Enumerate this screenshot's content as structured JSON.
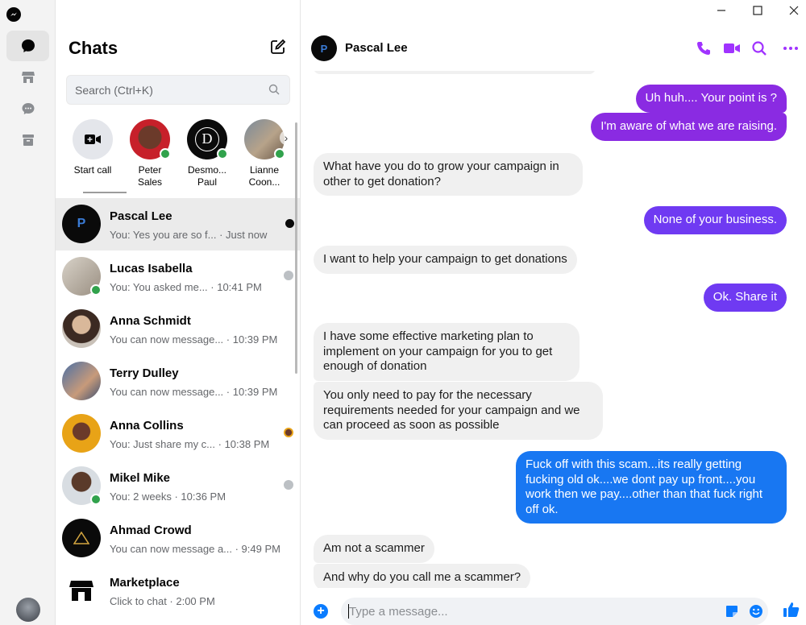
{
  "colors": {
    "accent_purple": "#a033ff",
    "bubble_in": "#f0f0f0",
    "bubble_purple": "#8a2be2",
    "bubble_violet": "#6f3af2",
    "bubble_blue": "#1877f2",
    "online": "#31a24c",
    "messenger_blue": "#0a7cff"
  },
  "window": {
    "minimize_icon": "minimize-icon",
    "maximize_icon": "maximize-icon",
    "close_icon": "close-icon"
  },
  "rail": {
    "items": [
      "chats-icon",
      "marketplace-icon",
      "requests-icon",
      "archive-icon"
    ]
  },
  "sidebar": {
    "title": "Chats",
    "search_placeholder": "Search (Ctrl+K)",
    "stories": [
      {
        "label": "Start call"
      },
      {
        "label": "Peter Sales",
        "online": true
      },
      {
        "label": "Desmo... Paul",
        "online": true
      },
      {
        "label": "Lianne Coon...",
        "online": true
      }
    ],
    "threads": [
      {
        "name": "Pascal Lee",
        "preview": "You: Yes you are so f... · Just now",
        "active": true
      },
      {
        "name": "Lucas Isabella",
        "preview": "You: You asked me... · 10:41 PM",
        "online": true
      },
      {
        "name": "Anna Schmidt",
        "preview": "You can now message... · 10:39 PM"
      },
      {
        "name": "Terry Dulley",
        "preview": "You can now message... · 10:39 PM"
      },
      {
        "name": "Anna Collins",
        "preview": "You: Just share my c... · 10:38 PM"
      },
      {
        "name": "Mikel Mike",
        "preview": "You: 2 weeks · 10:36 PM",
        "online": true
      },
      {
        "name": "Ahmad Crowd",
        "preview": "You can now message a... · 9:49 PM"
      },
      {
        "name": "Marketplace",
        "preview": "Click to chat · 2:00 PM"
      }
    ]
  },
  "conversation": {
    "contact_name": "Pascal Lee",
    "messages": [
      {
        "from": "me",
        "text": "Uh huh.... Your point is ?"
      },
      {
        "from": "me",
        "text": "I'm aware of what we are raising."
      },
      {
        "from": "them",
        "text": "What have you do to grow your campaign in other to get donation?"
      },
      {
        "from": "me",
        "text": "None of your business."
      },
      {
        "from": "them",
        "text": "I want to help your campaign to get donations"
      },
      {
        "from": "me",
        "text": "Ok. Share it"
      },
      {
        "from": "them",
        "text": "I have some effective marketing plan to implement on your campaign for you to get enough of donation"
      },
      {
        "from": "them",
        "text": "You only need to pay for the necessary requirements needed for your campaign and we can proceed as soon as possible"
      },
      {
        "from": "me",
        "text": "Fuck off with this scam...its really getting fucking old ok....we dont pay up front....you work then we pay....other than that fuck right off ok."
      },
      {
        "from": "them",
        "text": "Am not a scammer"
      },
      {
        "from": "them",
        "text": "And why do you call me a scammer?"
      }
    ],
    "composer_placeholder": "Type a message..."
  }
}
